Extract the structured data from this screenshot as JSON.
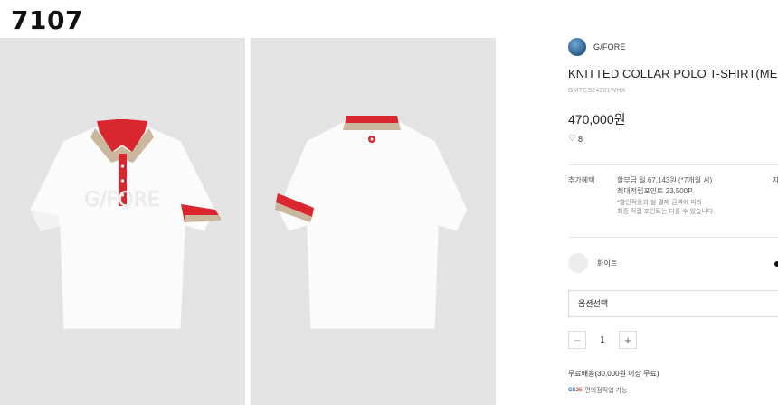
{
  "corner_label": "7107",
  "images": {
    "front_alt": "front-view-polo",
    "back_alt": "back-view-polo",
    "colors": {
      "background": "#e3e3e3",
      "shirt": "#fbfbfb",
      "collar_red": "#d9262f",
      "collar_beige": "#cbb79d"
    }
  },
  "brand": {
    "name": "G/FORE"
  },
  "product": {
    "title": "KNITTED COLLAR POLO T-SHIRT(MEN)",
    "code": "GMTCS24201WHX",
    "price": "470,000원",
    "likes": "8"
  },
  "benefit": {
    "label": "추가혜택",
    "installment": "할부금 월 67,143원 (*7개월 시)",
    "points": "최대적립포인트 23,500P",
    "note_line1": "*할인적용과 실 결제 금액에 따라",
    "note_line2": "최종 적립 포인트는 다를 수 있습니다.",
    "more": "자"
  },
  "color_option": {
    "name": "화이트",
    "swatch": "#ececec"
  },
  "option_select": {
    "label": "옵션선택"
  },
  "quantity": {
    "value": "1",
    "minus": "−",
    "plus": "+"
  },
  "shipping": {
    "text": "무료배송(30,000원 이상 무료)"
  },
  "pickup": {
    "badge_left": "GS",
    "badge_right": "25",
    "text": "편의점픽업 가능"
  }
}
